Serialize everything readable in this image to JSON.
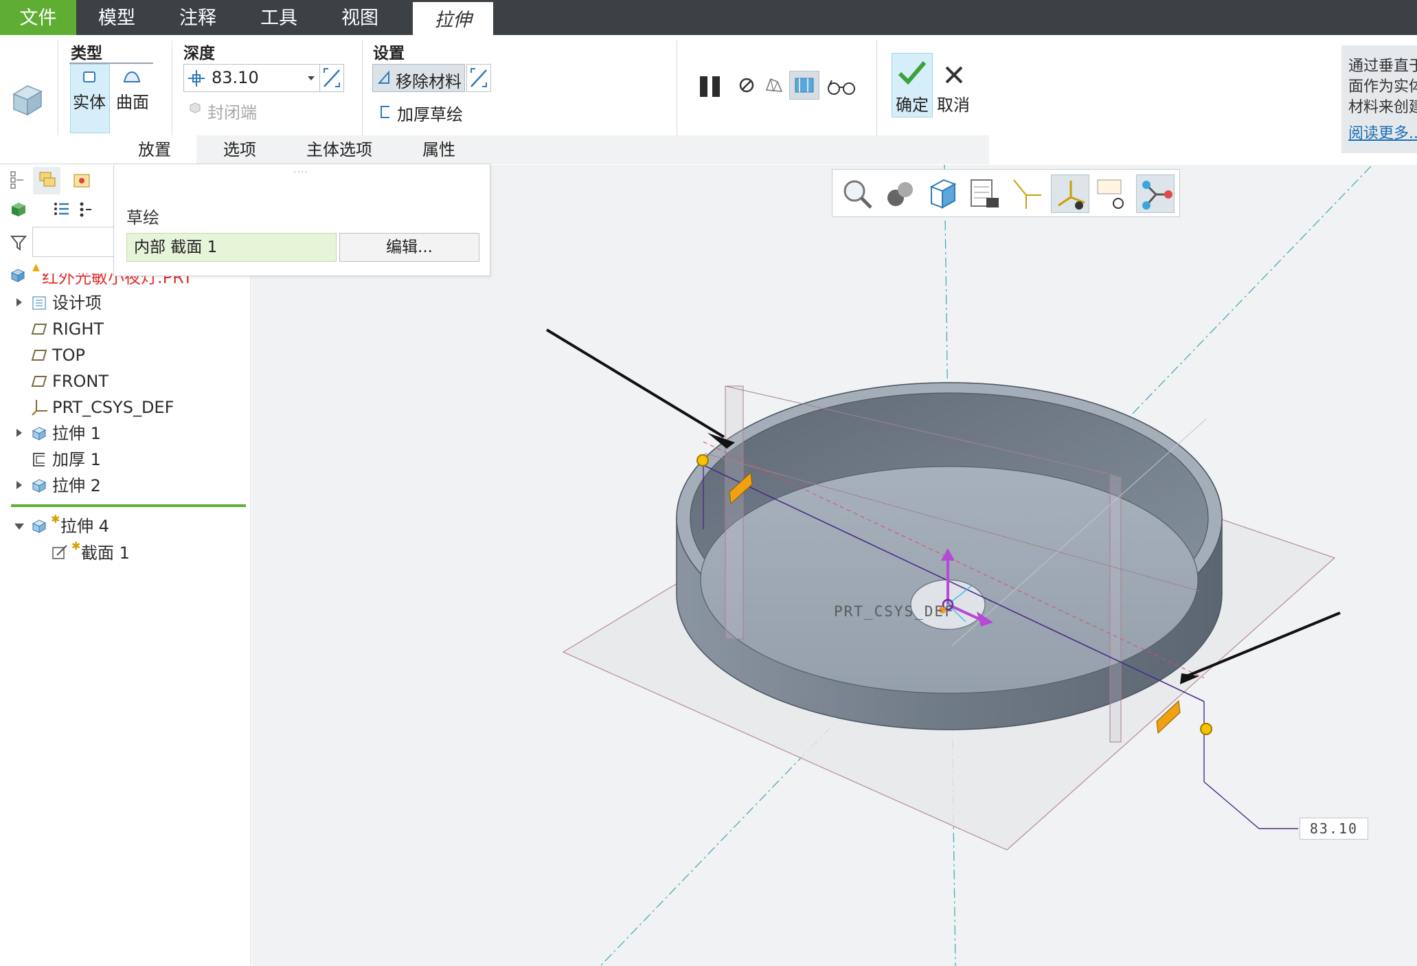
{
  "menubar": {
    "tabs": [
      {
        "label": "文件"
      },
      {
        "label": "模型"
      },
      {
        "label": "注释"
      },
      {
        "label": "工具"
      },
      {
        "label": "视图"
      },
      {
        "label": "拉伸"
      }
    ],
    "active_tab": "拉伸"
  },
  "ribbon": {
    "type_group": {
      "title": "类型",
      "solid_label": "实体",
      "surface_label": "曲面",
      "selected": "实体"
    },
    "depth_group": {
      "title": "深度",
      "value": "83.10",
      "closed_ends_label": "封闭端"
    },
    "settings_group": {
      "title": "设置",
      "remove_material_label": "移除材料",
      "thicken_sketch_label": "加厚草绘"
    },
    "ok_label": "确定",
    "cancel_label": "取消",
    "subtabs": [
      {
        "label": "放置"
      },
      {
        "label": "选项"
      },
      {
        "label": "主体选项"
      },
      {
        "label": "属性"
      }
    ],
    "active_subtab": "放置"
  },
  "help_panel": {
    "lines": [
      "通过垂直于",
      "面作为实体",
      "材料来创建"
    ],
    "link": "阅读更多..."
  },
  "placement_popup": {
    "section_label": "草绘",
    "sketch_value": "内部 截面 1",
    "edit_button": "编辑..."
  },
  "model_tree": {
    "root": "红外光敏小夜灯.PRT",
    "items": [
      {
        "label": "设计项",
        "icon": "design-items-icon",
        "expandable": true
      },
      {
        "label": "RIGHT",
        "icon": "datum-plane-icon",
        "expandable": false
      },
      {
        "label": "TOP",
        "icon": "datum-plane-icon",
        "expandable": false
      },
      {
        "label": "FRONT",
        "icon": "datum-plane-icon",
        "expandable": false
      },
      {
        "label": "PRT_CSYS_DEF",
        "icon": "csys-icon",
        "expandable": false
      },
      {
        "label": "拉伸 1",
        "icon": "extrude-icon",
        "expandable": true
      },
      {
        "label": "加厚 1",
        "icon": "thicken-icon",
        "expandable": false
      },
      {
        "label": "拉伸 2",
        "icon": "extrude-icon",
        "expandable": true
      }
    ],
    "active_feature": {
      "label": "拉伸 4",
      "icon": "extrude-icon"
    },
    "active_child": {
      "label": "截面 1",
      "icon": "sketch-icon"
    }
  },
  "graphics": {
    "csys_label": "PRT_CSYS_DEF",
    "dimension_value": "83.10"
  },
  "colors": {
    "menubar_bg": "#3c4146",
    "file_tab": "#5fae33",
    "accent_blue": "#1a6fb5",
    "model_gray": "#7d8894",
    "tree_red": "#e03030"
  }
}
